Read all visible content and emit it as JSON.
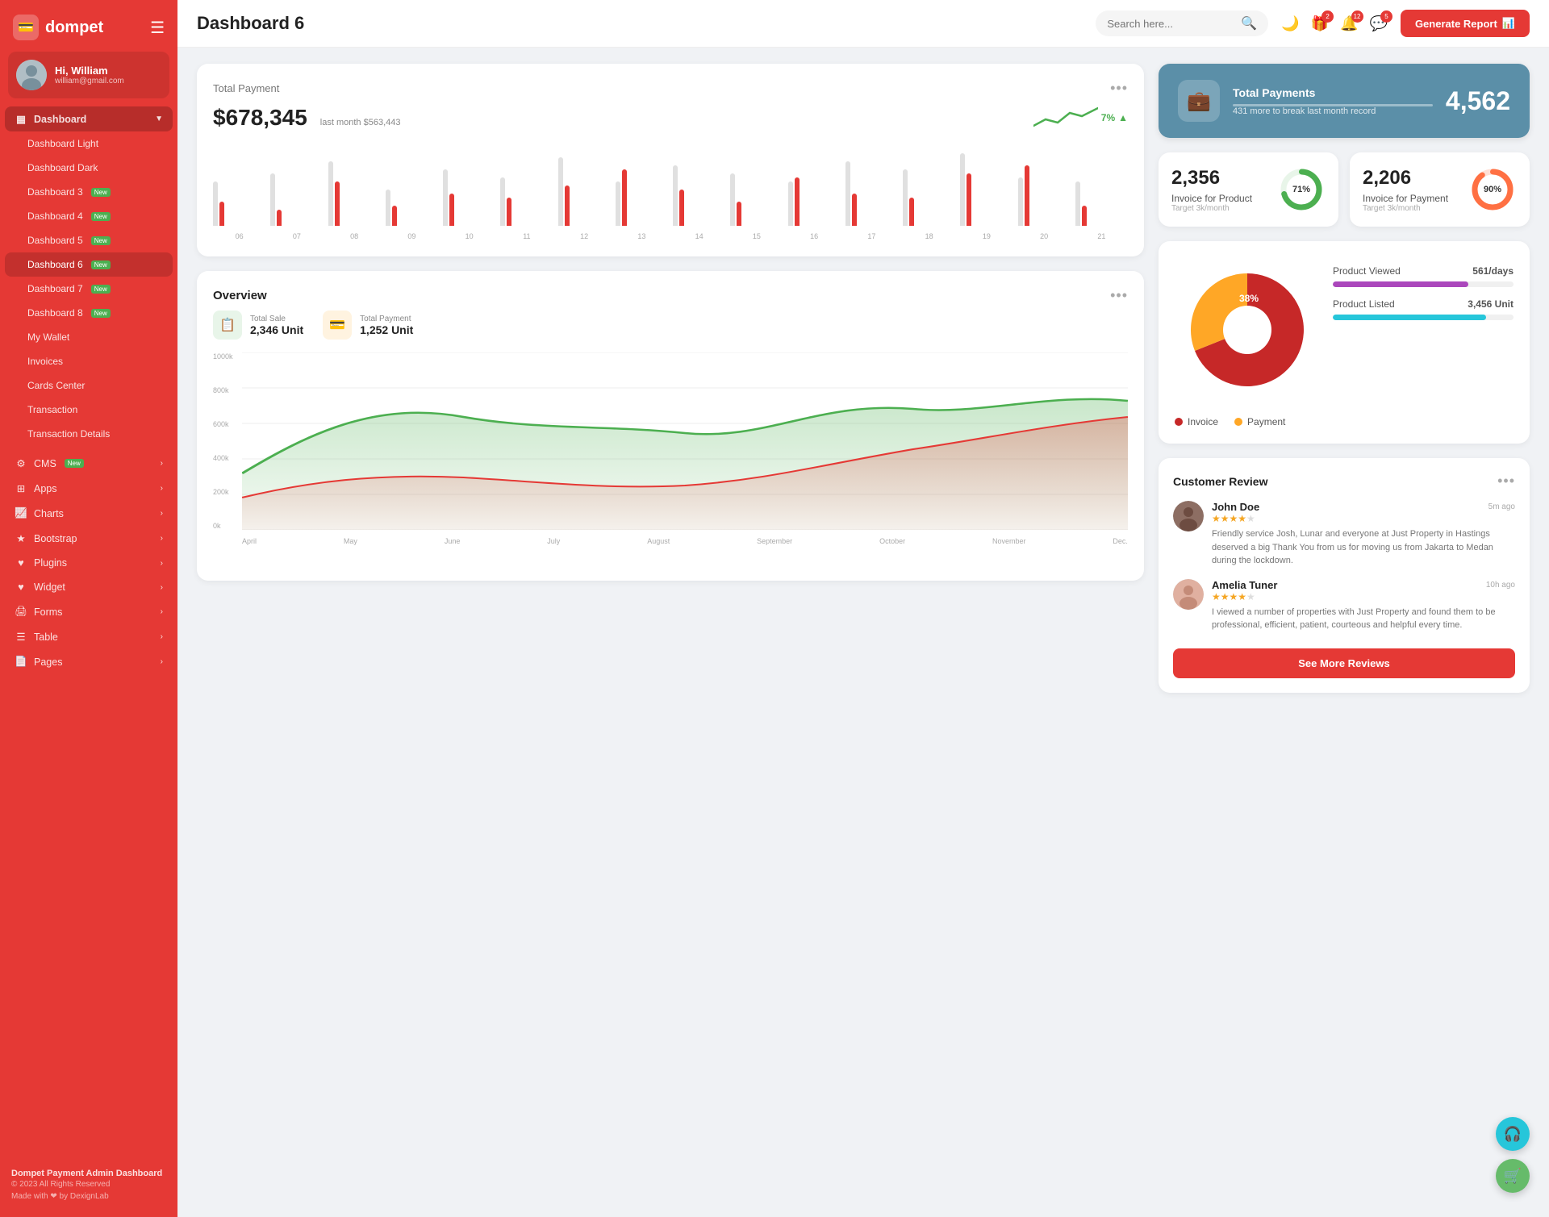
{
  "sidebar": {
    "logo": "dompet",
    "user": {
      "greeting": "Hi, William",
      "email": "william@gmail.com"
    },
    "nav": {
      "dashboard_label": "Dashboard",
      "items": [
        {
          "id": "dashboard-light",
          "label": "Dashboard Light",
          "sub": true,
          "badge": null
        },
        {
          "id": "dashboard-dark",
          "label": "Dashboard Dark",
          "sub": true,
          "badge": null
        },
        {
          "id": "dashboard-3",
          "label": "Dashboard 3",
          "sub": true,
          "badge": "New"
        },
        {
          "id": "dashboard-4",
          "label": "Dashboard 4",
          "sub": true,
          "badge": "New"
        },
        {
          "id": "dashboard-5",
          "label": "Dashboard 5",
          "sub": true,
          "badge": "New"
        },
        {
          "id": "dashboard-6",
          "label": "Dashboard 6",
          "sub": true,
          "badge": "New",
          "active": true
        },
        {
          "id": "dashboard-7",
          "label": "Dashboard 7",
          "sub": true,
          "badge": "New"
        },
        {
          "id": "dashboard-8",
          "label": "Dashboard 8",
          "sub": true,
          "badge": "New"
        },
        {
          "id": "my-wallet",
          "label": "My Wallet",
          "sub": true,
          "badge": null
        },
        {
          "id": "invoices",
          "label": "Invoices",
          "sub": true,
          "badge": null
        },
        {
          "id": "cards-center",
          "label": "Cards Center",
          "sub": true,
          "badge": null
        },
        {
          "id": "transaction",
          "label": "Transaction",
          "sub": true,
          "badge": null
        },
        {
          "id": "transaction-details",
          "label": "Transaction Details",
          "sub": true,
          "badge": null
        }
      ],
      "sections": [
        {
          "id": "cms",
          "label": "CMS",
          "badge": "New",
          "arrow": true
        },
        {
          "id": "apps",
          "label": "Apps",
          "arrow": true
        },
        {
          "id": "charts",
          "label": "Charts",
          "arrow": true
        },
        {
          "id": "bootstrap",
          "label": "Bootstrap",
          "arrow": true
        },
        {
          "id": "plugins",
          "label": "Plugins",
          "arrow": true
        },
        {
          "id": "widget",
          "label": "Widget",
          "arrow": true
        },
        {
          "id": "forms",
          "label": "Forms",
          "arrow": true
        },
        {
          "id": "table",
          "label": "Table",
          "arrow": true
        },
        {
          "id": "pages",
          "label": "Pages",
          "arrow": true
        }
      ]
    },
    "footer": {
      "brand": "Dompet Payment Admin Dashboard",
      "copy": "© 2023 All Rights Reserved",
      "made": "Made with ❤ by DexignLab"
    }
  },
  "topbar": {
    "title": "Dashboard 6",
    "search_placeholder": "Search here...",
    "badges": {
      "gift": 2,
      "bell": 12,
      "message": 5
    },
    "generate_btn": "Generate Report"
  },
  "total_payment": {
    "title": "Total Payment",
    "amount": "$678,345",
    "last_month": "last month $563,443",
    "trend": "7%",
    "bars": [
      {
        "grey": 55,
        "red": 30
      },
      {
        "grey": 65,
        "red": 20
      },
      {
        "grey": 80,
        "red": 55
      },
      {
        "grey": 45,
        "red": 25
      },
      {
        "grey": 70,
        "red": 40
      },
      {
        "grey": 60,
        "red": 35
      },
      {
        "grey": 85,
        "red": 50
      },
      {
        "grey": 55,
        "red": 70
      },
      {
        "grey": 75,
        "red": 45
      },
      {
        "grey": 65,
        "red": 30
      },
      {
        "grey": 55,
        "red": 60
      },
      {
        "grey": 80,
        "red": 40
      },
      {
        "grey": 70,
        "red": 35
      },
      {
        "grey": 90,
        "red": 65
      },
      {
        "grey": 60,
        "red": 75
      },
      {
        "grey": 55,
        "red": 25
      }
    ],
    "labels": [
      "06",
      "07",
      "08",
      "09",
      "10",
      "11",
      "12",
      "13",
      "14",
      "15",
      "16",
      "17",
      "18",
      "19",
      "20",
      "21"
    ]
  },
  "total_payments_blue": {
    "title": "Total Payments",
    "sub": "431 more to break last month record",
    "value": "4,562"
  },
  "invoice_product": {
    "number": "2,356",
    "label": "Invoice for Product",
    "target": "Target 3k/month",
    "percent": 71,
    "color": "#4caf50"
  },
  "invoice_payment": {
    "number": "2,206",
    "label": "Invoice for Payment",
    "target": "Target 3k/month",
    "percent": 90,
    "color": "#ff7043"
  },
  "overview": {
    "title": "Overview",
    "total_sale_label": "Total Sale",
    "total_sale_value": "2,346 Unit",
    "total_payment_label": "Total Payment",
    "total_payment_value": "1,252 Unit",
    "y_labels": [
      "1000k",
      "800k",
      "600k",
      "400k",
      "200k",
      "0k"
    ],
    "x_labels": [
      "April",
      "May",
      "June",
      "July",
      "August",
      "September",
      "October",
      "November",
      "Dec."
    ]
  },
  "pie_chart": {
    "invoice_pct": 62,
    "payment_pct": 38,
    "invoice_label": "Invoice",
    "payment_label": "Payment",
    "invoice_color": "#c62828",
    "payment_color": "#ffa726"
  },
  "product_stats": [
    {
      "label": "Product Viewed",
      "value": "561/days",
      "percent": 75,
      "color": "#ab47bc"
    },
    {
      "label": "Product Listed",
      "value": "3,456 Unit",
      "percent": 85,
      "color": "#26c6da"
    }
  ],
  "customer_review": {
    "title": "Customer Review",
    "reviews": [
      {
        "name": "John Doe",
        "time": "5m ago",
        "stars": 4,
        "text": "Friendly service Josh, Lunar and everyone at Just Property in Hastings deserved a big Thank You from us for moving us from Jakarta to Medan during the lockdown."
      },
      {
        "name": "Amelia Tuner",
        "time": "10h ago",
        "stars": 4,
        "text": "I viewed a number of properties with Just Property and found them to be professional, efficient, patient, courteous and helpful every time."
      }
    ],
    "see_more_btn": "See More Reviews"
  },
  "fab": {
    "headphone_icon": "🎧",
    "cart_icon": "🛒"
  }
}
